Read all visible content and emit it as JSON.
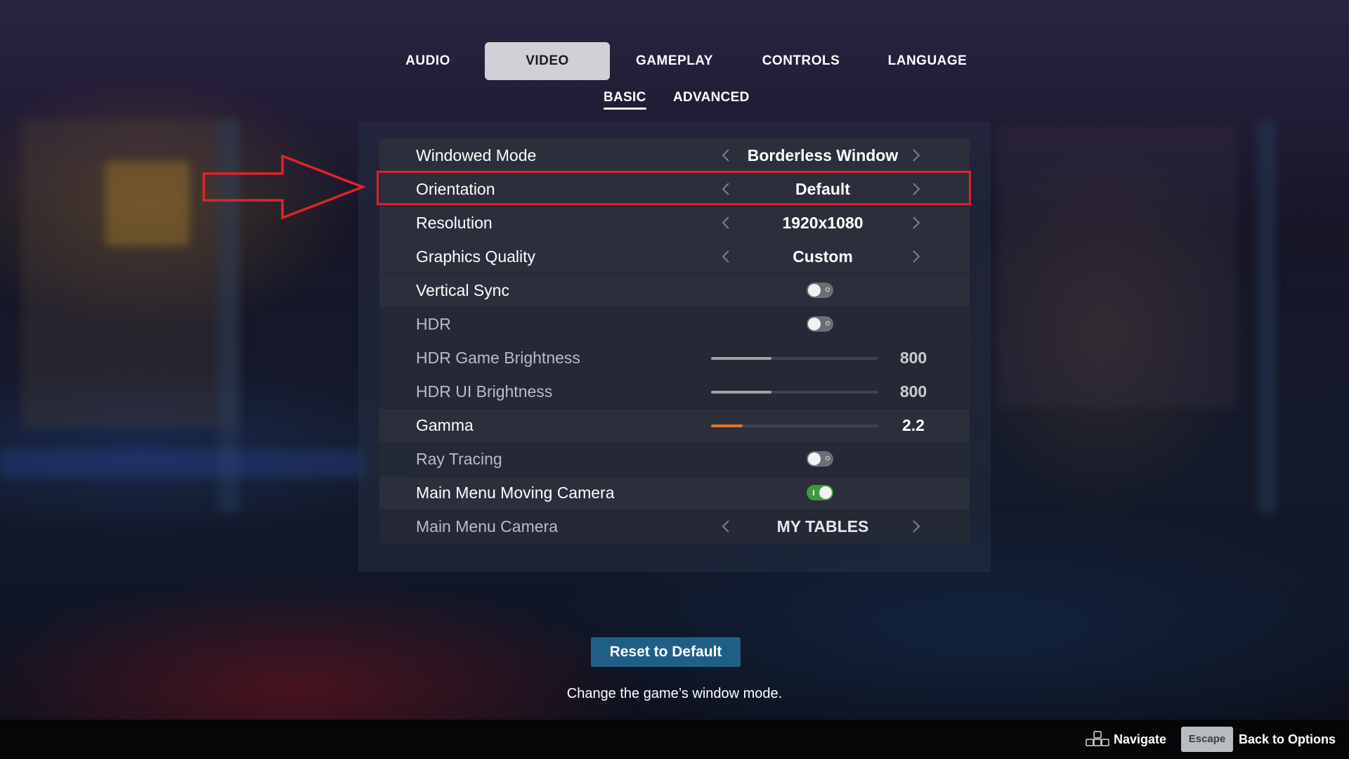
{
  "tabs": {
    "main": [
      {
        "label": "AUDIO",
        "active": false
      },
      {
        "label": "VIDEO",
        "active": true
      },
      {
        "label": "GAMEPLAY",
        "active": false
      },
      {
        "label": "CONTROLS",
        "active": false
      },
      {
        "label": "LANGUAGE",
        "active": false
      }
    ],
    "sub": [
      {
        "label": "BASIC",
        "active": true
      },
      {
        "label": "ADVANCED",
        "active": false
      }
    ]
  },
  "settings": {
    "windowed_mode": {
      "label": "Windowed Mode",
      "value": "Borderless Window"
    },
    "orientation": {
      "label": "Orientation",
      "value": "Default"
    },
    "resolution": {
      "label": "Resolution",
      "value": "1920x1080"
    },
    "graphics_quality": {
      "label": "Graphics Quality",
      "value": "Custom"
    },
    "vertical_sync": {
      "label": "Vertical Sync",
      "enabled": false
    },
    "hdr": {
      "label": "HDR",
      "enabled": false
    },
    "hdr_game_brightness": {
      "label": "HDR Game Brightness",
      "value": "800",
      "level": 0.36
    },
    "hdr_ui_brightness": {
      "label": "HDR UI Brightness",
      "value": "800",
      "level": 0.36
    },
    "gamma": {
      "label": "Gamma",
      "value": "2.2",
      "level": 0.19
    },
    "ray_tracing": {
      "label": "Ray Tracing",
      "enabled": false
    },
    "main_menu_moving_camera": {
      "label": "Main Menu Moving Camera",
      "enabled": true
    },
    "main_menu_camera": {
      "label": "Main Menu Camera",
      "value": "MY TABLES"
    }
  },
  "reset_button": {
    "label": "Reset to Default"
  },
  "description": "Change the game’s window mode.",
  "footer": {
    "navigate_label": "Navigate",
    "escape_key": "Escape",
    "back_label": "Back to Options"
  },
  "colors": {
    "accent_orange": "#e8712c",
    "toggle_on_green": "#3d9b3f",
    "annotation_red": "#e0222b",
    "reset_button_blue": "#1f5f86"
  },
  "annotation": {
    "highlighted_setting": "orientation"
  }
}
